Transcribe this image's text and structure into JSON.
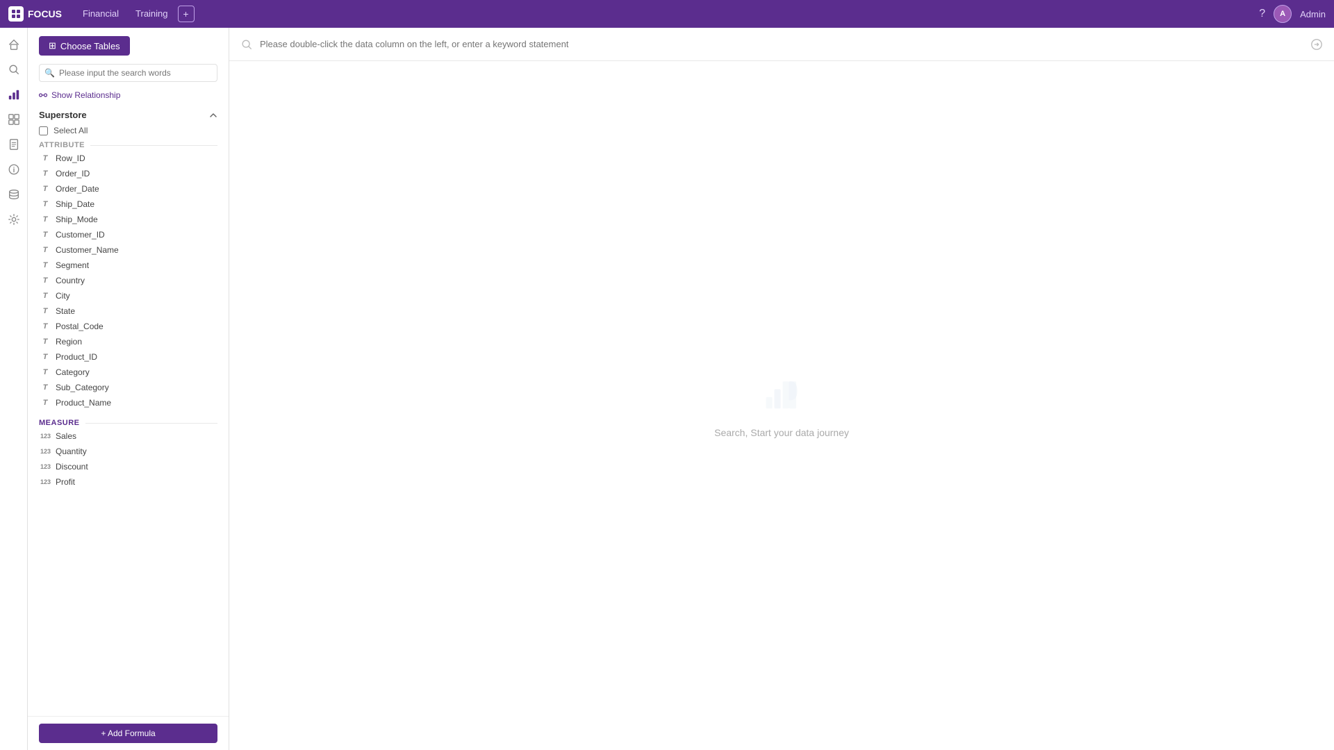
{
  "app": {
    "logo_text": "FOCUS",
    "nav_items": [
      "Financial",
      "Training"
    ],
    "add_tab_label": "+",
    "help_label": "?",
    "user_initials": "A",
    "username": "Admin"
  },
  "sidebar_icons": [
    {
      "name": "home-icon",
      "symbol": "⌂"
    },
    {
      "name": "search-icon",
      "symbol": "🔍"
    },
    {
      "name": "analytics-icon",
      "symbol": "📊"
    },
    {
      "name": "grid-icon",
      "symbol": "⊞"
    },
    {
      "name": "doc-icon",
      "symbol": "📄"
    },
    {
      "name": "info-icon",
      "symbol": "ℹ"
    },
    {
      "name": "database-icon",
      "symbol": "🗄"
    },
    {
      "name": "settings-icon",
      "symbol": "⚙"
    }
  ],
  "left_panel": {
    "choose_tables_label": "Choose Tables",
    "search_placeholder": "Please input the search words",
    "show_relationship_label": "Show Relationship",
    "table_name": "Superstore",
    "select_all_label": "Select All",
    "attribute_label": "Attribute",
    "attribute_fields": [
      "Row_ID",
      "Order_ID",
      "Order_Date",
      "Ship_Date",
      "Ship_Mode",
      "Customer_ID",
      "Customer_Name",
      "Segment",
      "Country",
      "City",
      "State",
      "Postal_Code",
      "Region",
      "Product_ID",
      "Category",
      "Sub_Category",
      "Product_Name"
    ],
    "measure_label": "Measure",
    "measure_fields": [
      "Sales",
      "Quantity",
      "Discount",
      "Profit"
    ],
    "add_formula_label": "+ Add Formula"
  },
  "query_bar": {
    "placeholder": "Please double-click the data column on the left, or enter a keyword statement"
  },
  "empty_state": {
    "text": "Search, Start your data journey"
  }
}
